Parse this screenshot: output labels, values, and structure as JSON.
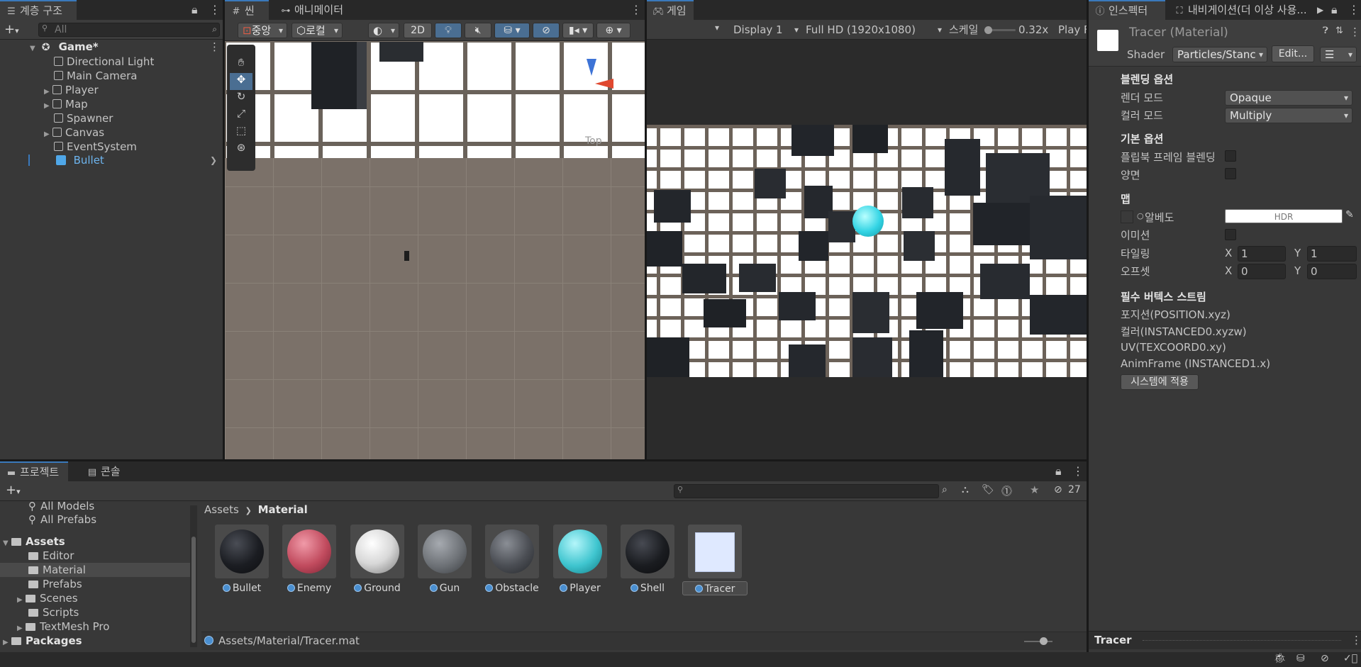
{
  "hierarchy": {
    "tab": "계층 구조",
    "search_placeholder": "All",
    "root": "Game*",
    "items": [
      {
        "label": "Directional Light"
      },
      {
        "label": "Main Camera"
      },
      {
        "label": "Player"
      },
      {
        "label": "Map"
      },
      {
        "label": "Spawner"
      },
      {
        "label": "Canvas"
      },
      {
        "label": "EventSystem"
      },
      {
        "label": "Bullet"
      }
    ]
  },
  "scene": {
    "tabs": [
      "씬",
      "애니메이터"
    ],
    "pivot": "중앙",
    "space": "로컬",
    "mode_2d": "2D",
    "gizmo_label": "Top",
    "gizmo_x": "x",
    "gizmo_z": "z"
  },
  "game": {
    "tab": "게임",
    "display": "Display 1",
    "resolution": "Full HD (1920x1080)",
    "scale_label": "스케일",
    "scale_value": "0.32x",
    "play_label": "Play F"
  },
  "inspector": {
    "tabs": [
      "인스펙터",
      "내비게이션(더 이상 사용..."
    ],
    "title": "Tracer (Material)",
    "shader_label": "Shader",
    "shader_value": "Particles/Stanc",
    "edit_button": "Edit...",
    "section_blending": "블렌딩 옵션",
    "render_mode_label": "렌더 모드",
    "render_mode_value": "Opaque",
    "color_mode_label": "컬러 모드",
    "color_mode_value": "Multiply",
    "section_basic": "기본 옵션",
    "flipbook_label": "플립북 프레임 블렌딩",
    "two_sided_label": "양면",
    "section_maps": "맵",
    "albedo_label": "알베도",
    "albedo_value": "HDR",
    "emission_label": "이미션",
    "tiling_label": "타일링",
    "offset_label": "오프셋",
    "tiling_x": "1",
    "tiling_y": "1",
    "offset_x": "0",
    "offset_y": "0",
    "axis_x": "X",
    "axis_y": "Y",
    "section_streams": "필수 버텍스 스트림",
    "streams": [
      "포지션(POSITION.xyz)",
      "컬러(INSTANCED0.xyzw)",
      "UV(TEXCOORD0.xy)",
      "AnimFrame (INSTANCED1.x)"
    ],
    "apply_button": "시스템에 적용",
    "preview_label": "Tracer"
  },
  "project": {
    "tabs": [
      "프로젝트",
      "콘솔"
    ],
    "hidden_count": "27",
    "tree": [
      {
        "label": "All Models"
      },
      {
        "label": "All Prefabs"
      },
      {
        "label": "Assets"
      },
      {
        "label": "Editor"
      },
      {
        "label": "Material"
      },
      {
        "label": "Prefabs"
      },
      {
        "label": "Scenes"
      },
      {
        "label": "Scripts"
      },
      {
        "label": "TextMesh Pro"
      },
      {
        "label": "Packages"
      }
    ],
    "breadcrumb": [
      "Assets",
      "Material"
    ],
    "assets": [
      {
        "label": "Bullet",
        "color": "#1b1d22"
      },
      {
        "label": "Enemy",
        "color": "#c14b5e"
      },
      {
        "label": "Ground",
        "color": "#d8d8d8"
      },
      {
        "label": "Gun",
        "color": "#6e7277"
      },
      {
        "label": "Obstacle",
        "color": "#4b4e54"
      },
      {
        "label": "Player",
        "color": "#3fc5cf"
      },
      {
        "label": "Shell",
        "color": "#1a1c20"
      },
      {
        "label": "Tracer",
        "color": "#dfe9ff"
      }
    ],
    "path": "Assets/Material/Tracer.mat"
  }
}
